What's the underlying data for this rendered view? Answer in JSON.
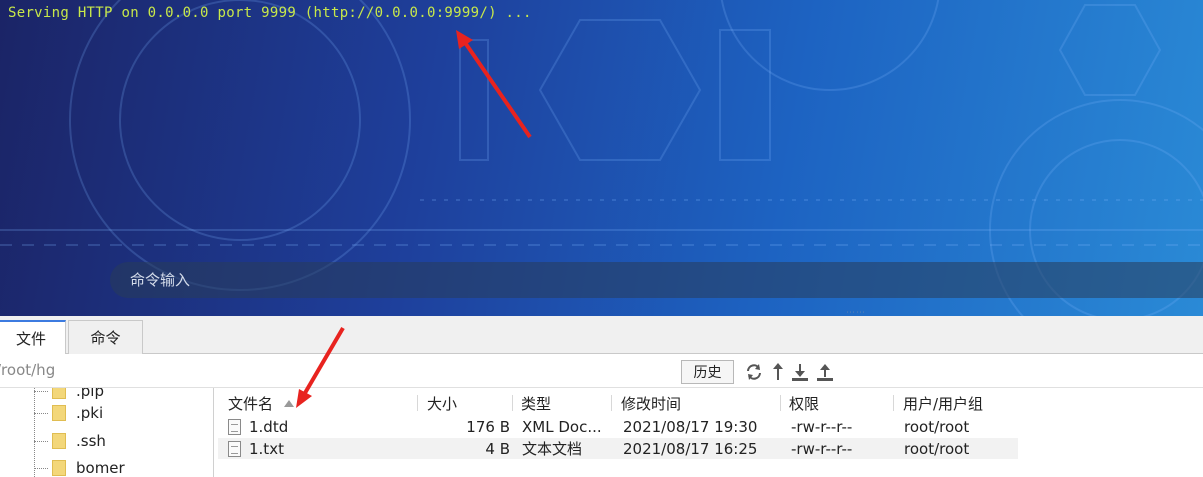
{
  "terminal": {
    "output_line": "Serving HTTP on 0.0.0.0 port 9999 (http://0.0.0.0:9999/) ...",
    "command_placeholder": "命令输入",
    "splitter": "⋯⋯"
  },
  "tabs": [
    {
      "label": "文件",
      "active": true
    },
    {
      "label": "命令",
      "active": false
    }
  ],
  "path": {
    "value": "/root/hg",
    "history_label": "历史",
    "toolbar_icons": [
      "refresh-icon",
      "up-arrow-icon",
      "download-icon",
      "upload-icon"
    ]
  },
  "tree": {
    "items": [
      {
        "name": ".pip"
      },
      {
        "name": ".pki"
      },
      {
        "name": ".ssh"
      },
      {
        "name": "bomer"
      }
    ]
  },
  "filelist": {
    "columns": {
      "name": "文件名",
      "size": "大小",
      "type": "类型",
      "modified": "修改时间",
      "perm": "权限",
      "owner": "用户/用户组"
    },
    "rows": [
      {
        "name": "1.dtd",
        "size": "176 B",
        "type": "XML Doc...",
        "modified": "2021/08/17 19:30",
        "perm": "-rw-r--r--",
        "owner": "root/root"
      },
      {
        "name": "1.txt",
        "size": "4 B",
        "type": "文本文档",
        "modified": "2021/08/17 16:25",
        "perm": "-rw-r--r--",
        "owner": "root/root"
      }
    ]
  },
  "annotations": {
    "arrow_color": "#e8231f"
  }
}
